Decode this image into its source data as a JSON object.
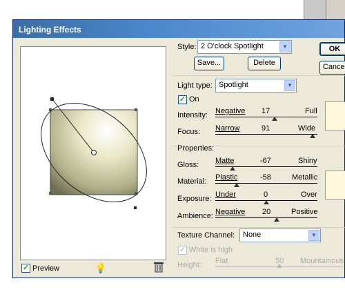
{
  "window": {
    "title": "Lighting Effects"
  },
  "buttons": {
    "ok": "OK",
    "cancel": "Cancel",
    "save": "Save...",
    "delete": "Delete"
  },
  "style": {
    "label": "Style:",
    "value": "2 O'clock Spotlight"
  },
  "light_type": {
    "label": "Light type:",
    "value": "Spotlight",
    "on_label": "On",
    "on_checked": true
  },
  "sliders": {
    "intensity": {
      "label": "Intensity:",
      "min_label": "Negative",
      "value": "17",
      "max_label": "Full",
      "fraction": 0.58
    },
    "focus": {
      "label": "Focus:",
      "min_label": "Narrow",
      "value": "91",
      "max_label": "Wide",
      "fraction": 0.95
    },
    "gloss": {
      "label": "Gloss:",
      "min_label": "Matte",
      "value": "-67",
      "max_label": "Shiny",
      "fraction": 0.17
    },
    "material": {
      "label": "Material:",
      "min_label": "Plastic",
      "value": "-58",
      "max_label": "Metallic",
      "fraction": 0.21
    },
    "exposure": {
      "label": "Exposure:",
      "min_label": "Under",
      "value": "0",
      "max_label": "Over",
      "fraction": 0.5
    },
    "ambience": {
      "label": "Ambience:",
      "min_label": "Negative",
      "value": "20",
      "max_label": "Positive",
      "fraction": 0.6
    },
    "height": {
      "label": "Height:",
      "min_label": "Flat",
      "value": "50",
      "max_label": "Mountainous",
      "fraction": 0.5
    }
  },
  "properties_label": "Properties:",
  "texture": {
    "label": "Texture Channel:",
    "value": "None",
    "white_is_high": "White is high"
  },
  "preview": {
    "label": "Preview",
    "checked": true
  },
  "colors": {
    "light_swatch": "#fff8dc",
    "title_bar": "#3a6ea5"
  }
}
